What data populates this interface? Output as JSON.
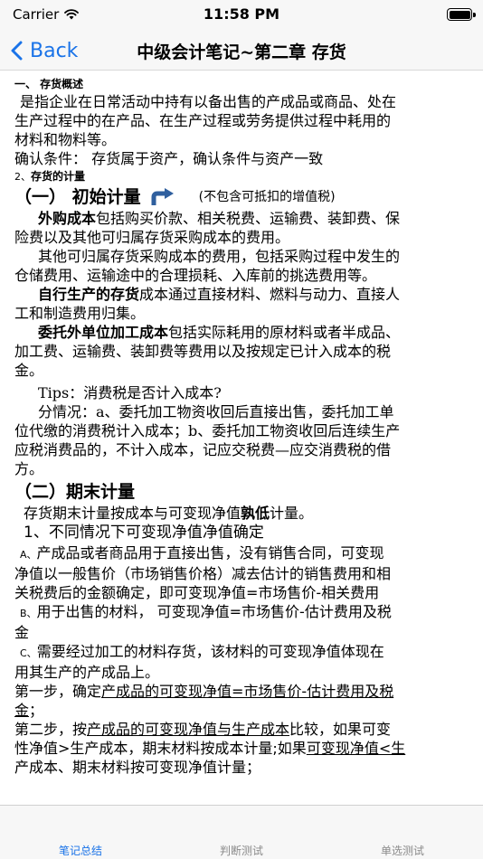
{
  "status": {
    "carrier": "Carrier",
    "time": "11:58 PM"
  },
  "nav": {
    "back_label": "Back",
    "title": "中级会计笔记~第二章 存货"
  },
  "content": {
    "l1": "一、 存货概述",
    "l2": "是指企业在日常活动中持有以备出售的产成品或商品、处在",
    "l3": "生产过程中的在产品、在生产过程或劳务提供过程中耗用的",
    "l4": "材料和物料等。",
    "l5": "确认条件： 存货属于资产，确认条件与资产一致",
    "l6_num": "2、",
    "l6": "存货的计量",
    "h_initial": "（一） 初始计量",
    "h_initial_note": "(不包含可抵扣的增值税)",
    "p1_b": "外购成本",
    "p1_a": "包括购买价款、相关税费、运输费、装卸费、保",
    "p1_c": "险费以及其他可归属存货采购成本的费用。",
    "p2_a": "其他可归属存货采购成本的费用，包括采购过程中发生的",
    "p2_b": "仓储费用、运输途中的合理损耗、入库前的挑选费用等。",
    "p3_b": "自行生产的存货",
    "p3_a": "成本通过直接材料、燃料与动力、直接人",
    "p3_c": "工和制造费用归集。",
    "p4_b": "委托外单位加工成本",
    "p4_a": "包括实际耗用的原材料或者半成品、",
    "p4_c": "加工费、运输费、装卸费等费用以及按规定已计入成本的税",
    "p4_d": "金。",
    "tips": "Tips：消费税是否计入成本?",
    "s1": "分情况：a、委托加工物资收回后直接出售，委托加工单",
    "s2": "位代缴的消费税计入成本；b、委托加工物资收回后连续生产",
    "s3": "应税消费品的，不计入成本，记应交税费—应交消费税的借",
    "s4": "方。",
    "h_end": "（二）期末计量",
    "e1_a": "存货期末计量按成本与可变现净值",
    "e1_b": "孰低",
    "e1_c": "计量。",
    "e2": "1、不同情况下可变现净值净值确定",
    "a_mark": "A、",
    "a1": "产成品或者商品用于直接出售，没有销售合同，可变现",
    "a2": "净值以一般售价（市场销售价格）减去估计的销售费用和相",
    "a3": "关税费后的金额确定，即可变现净值=市场售价-相关费用",
    "b_mark": "B、",
    "b1": "用于出售的材料， 可变现净值=市场售价-估计费用及税",
    "b2": "金",
    "c_mark": "C、",
    "c1": "需要经过加工的材料存货，该材料的可变现净值体现在",
    "c2": "用其生产的产成品上。",
    "st1_a": "第一步，确定",
    "st1_u": "产成品的可变现净值=市场售价-估计费用及税",
    "st1_u2": "金",
    "st1_c": "；",
    "st2_a": "第二步，按",
    "st2_u": "产成品的可变现净值与生产成本",
    "st2_b": "比较，如果可变",
    "st3_a": "性净值>生产成本，期末材料按成本计量;如果",
    "st3_u": "可变现净值<生",
    "st4": "产成本、期末材料按可变现净值计量；"
  },
  "tabs": {
    "t1": "笔记总结",
    "t2": "判断测试",
    "t3": "单选测试"
  },
  "colors": {
    "accent": "#1a73e8",
    "bar_bg": "#f7f7f7"
  }
}
